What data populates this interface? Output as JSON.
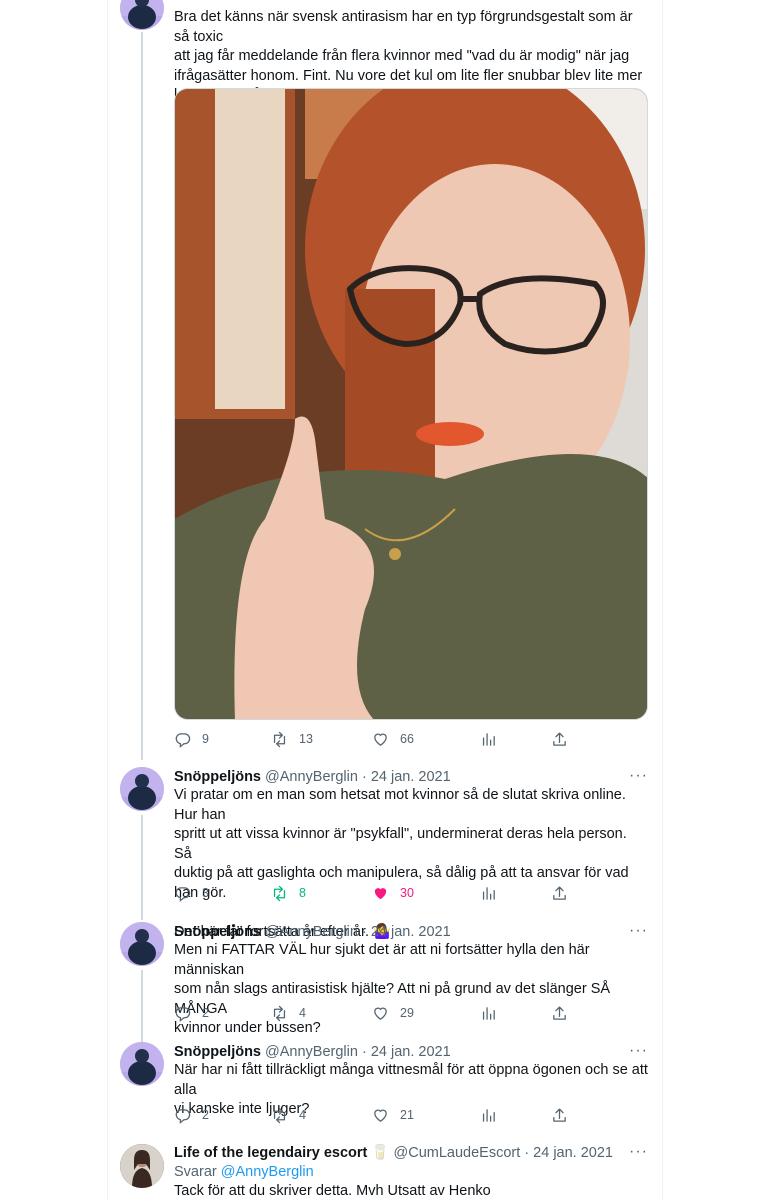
{
  "tweets": [
    {
      "text": "Bra det känns när svensk antirasism har en typ förgrundsgestalt som är så toxic\natt jag får meddelande från flera kvinnor med \"vad du är modig\" när jag\nifrågasätter honom. Fint. Nu vore det kul om lite fler snubbar blev lite mer\nkritiska också, kanske?",
      "replies": "9",
      "retweets": "13",
      "likes": "66"
    },
    {
      "name": "Snöppeljöns",
      "handle": "@AnnyBerglin",
      "date": "24 jan. 2021",
      "text": "Vi pratar om en man som hetsat mot kvinnor så de slutat skriva online. Hur han\nspritt ut att vissa kvinnor är \"psykfall\", underminerat deras hela person. Så\nduktig på att gaslighta och manipulera, så dålig på att ta ansvar för vad han gör.\n\nDet här får fortsätta år efter år. 🤷‍♀️",
      "replies": "3",
      "retweets": "8",
      "likes": "30"
    },
    {
      "name": "Snöppeljöns",
      "handle": "@AnnyBerglin",
      "date": "24 jan. 2021",
      "text": "Men ni FATTAR VÄL hur sjukt det är att ni fortsätter hylla den här människan\nsom nån slags antirasistisk hjälte? Att ni på grund av det slänger SÅ MÅNGA\nkvinnor under bussen?",
      "replies": "2",
      "retweets": "4",
      "likes": "29"
    },
    {
      "name": "Snöppeljöns",
      "handle": "@AnnyBerglin",
      "date": "24 jan. 2021",
      "text": "När har ni fått tillräckligt många vittnesmål för att öppna ögonen och se att alla\nvi kanske inte ljuger?",
      "replies": "2",
      "retweets": "4",
      "likes": "21"
    },
    {
      "name": "Life of the legendairy escort 🥛",
      "handle": "@CumLaudeEscort",
      "date": "24 jan. 2021",
      "replying_label": "Svarar",
      "replying_to": "@AnnyBerglin",
      "text": "Tack för att du skriver detta. Mvh Utsatt av Henko"
    }
  ],
  "dot": "·",
  "more": "···",
  "icons": [
    "reply-icon",
    "retweet-icon",
    "like-icon",
    "views-icon",
    "share-icon"
  ],
  "colors": {
    "retweeted": "#00ba7c",
    "liked": "#f91880",
    "link": "#1d9bf0",
    "muted": "#536471"
  }
}
